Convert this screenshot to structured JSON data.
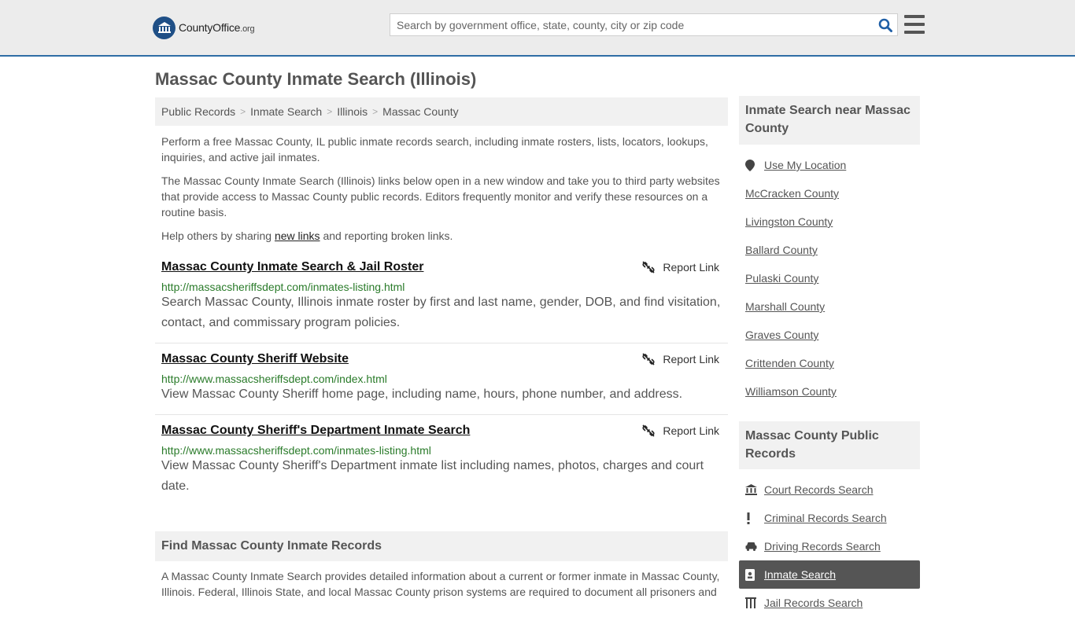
{
  "header": {
    "logo_main": "CountyOffice",
    "logo_tld": ".org",
    "search_placeholder": "Search by government office, state, county, city or zip code"
  },
  "page_title": "Massac County Inmate Search (Illinois)",
  "breadcrumb": [
    "Public Records",
    "Inmate Search",
    "Illinois",
    "Massac County"
  ],
  "intro": {
    "p1": "Perform a free Massac County, IL public inmate records search, including inmate rosters, lists, locators, lookups, inquiries, and active jail inmates.",
    "p2": "The Massac County Inmate Search (Illinois) links below open in a new window and take you to third party websites that provide access to Massac County public records. Editors frequently monitor and verify these resources on a routine basis.",
    "p3_before": "Help others by sharing ",
    "p3_link": "new links",
    "p3_after": " and reporting broken links."
  },
  "report_label": "Report Link",
  "results": [
    {
      "title": "Massac County Inmate Search & Jail Roster",
      "url": "http://massacsheriffsdept.com/inmates-listing.html",
      "desc": "Search Massac County, Illinois inmate roster by first and last name, gender, DOB, and find visitation, contact, and commissary program policies."
    },
    {
      "title": "Massac County Sheriff Website",
      "url": "http://www.massacsheriffsdept.com/index.html",
      "desc": "View Massac County Sheriff home page, including name, hours, phone number, and address."
    },
    {
      "title": "Massac County Sheriff's Department Inmate Search",
      "url": "http://www.massacsheriffsdept.com/inmates-listing.html",
      "desc": "View Massac County Sheriff's Department inmate list including names, photos, charges and court date."
    }
  ],
  "find_section": {
    "heading": "Find Massac County Inmate Records",
    "text": "A Massac County Inmate Search provides detailed information about a current or former inmate in Massac County, Illinois. Federal, Illinois State, and local Massac County prison systems are required to document all prisoners and"
  },
  "sidebar": {
    "nearby_heading": "Inmate Search near Massac County",
    "nearby": [
      "Use My Location",
      "McCracken County",
      "Livingston County",
      "Ballard County",
      "Pulaski County",
      "Marshall County",
      "Graves County",
      "Crittenden County",
      "Williamson County"
    ],
    "records_heading": "Massac County Public Records",
    "records": [
      {
        "label": "Court Records Search",
        "icon": "courthouse-icon"
      },
      {
        "label": "Criminal Records Search",
        "icon": "exclamation-icon"
      },
      {
        "label": "Driving Records Search",
        "icon": "car-icon"
      },
      {
        "label": "Inmate Search",
        "icon": "id-badge-icon",
        "active": true
      },
      {
        "label": "Jail Records Search",
        "icon": "jail-icon"
      }
    ]
  },
  "colors": {
    "header_bg": "#ececec",
    "header_border": "#2f6da5",
    "url_green": "#2a7b2a",
    "active_item_bg": "#555555"
  }
}
